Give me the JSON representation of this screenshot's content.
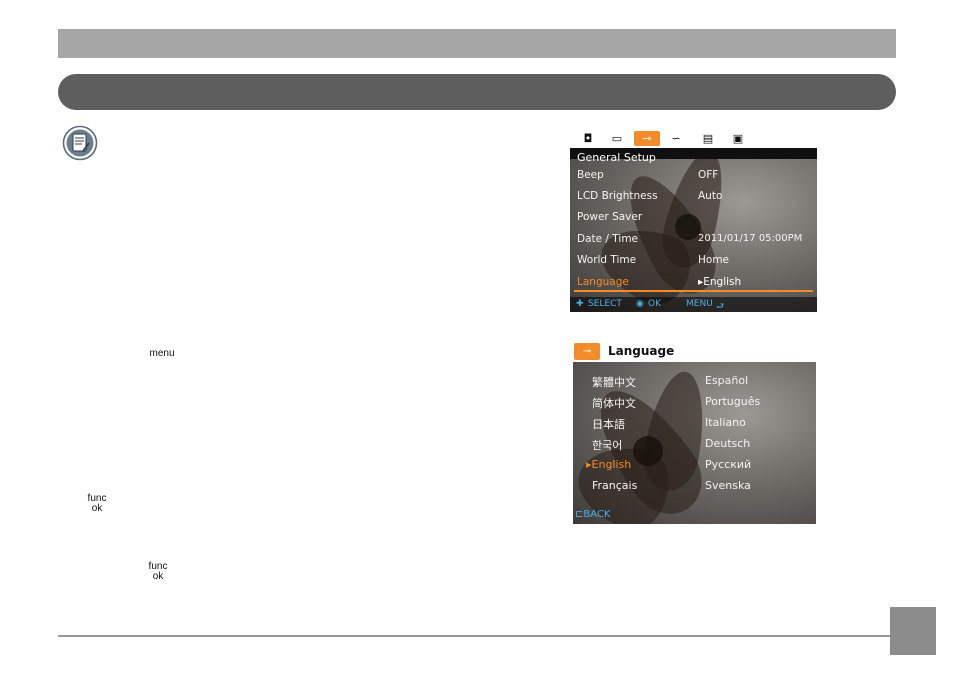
{
  "page": {
    "inline_keys": {
      "menu_key": "menu",
      "func_ok_1": {
        "line1": "func",
        "line2": "ok"
      },
      "func_ok_2": {
        "line1": "func",
        "line2": "ok"
      }
    },
    "icons": {
      "note": "note-icon"
    }
  },
  "screen1": {
    "tabs": [
      {
        "icon": "camera-icon",
        "glyph": "◘"
      },
      {
        "icon": "frame-icon",
        "glyph": "▭"
      },
      {
        "icon": "wrench-icon",
        "glyph": "⊸",
        "active": true
      },
      {
        "icon": "transfer-icon",
        "glyph": "∽"
      },
      {
        "icon": "print-icon",
        "glyph": "▤"
      },
      {
        "icon": "display-icon",
        "glyph": "▣"
      }
    ],
    "header": "General Setup",
    "rows": [
      {
        "label": "Beep",
        "value": "OFF"
      },
      {
        "label": "LCD Brightness",
        "value": "Auto"
      },
      {
        "label": "Power Saver",
        "value": ""
      },
      {
        "label": "Date / Time",
        "value": "2011/01/17 05:00PM"
      },
      {
        "label": "World Time",
        "value": "Home"
      },
      {
        "label": "Language",
        "value": "▸English",
        "selected": true
      }
    ],
    "footer": {
      "select": "SELECT",
      "ok": "OK",
      "menu": "MENU"
    }
  },
  "screen2": {
    "title": "Language",
    "left_col": [
      "繁體中文",
      "简体中文",
      "日本語",
      "한국어",
      "▸English",
      "Français"
    ],
    "right_col": [
      "Español",
      "Português",
      "Italiano",
      "Deutsch",
      "Русский",
      "Svenska"
    ],
    "selected": "▸English",
    "back": "BACK"
  },
  "colors": {
    "accent": "#f28c28",
    "hint_blue": "#4ab0e8",
    "top_bar": "#a6a6a6",
    "section_bar": "#5e5e5e",
    "page_box": "#8c8c8c"
  }
}
